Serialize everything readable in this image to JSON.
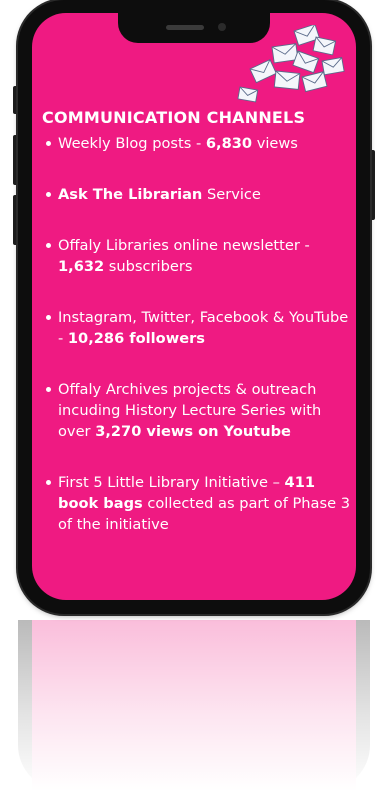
{
  "heading": "COMMUNICATION CHANNELS",
  "items": [
    {
      "parts": [
        {
          "t": "Weekly Blog posts - ",
          "b": false
        },
        {
          "t": "6,830",
          "b": true
        },
        {
          "t": " views",
          "b": false
        }
      ]
    },
    {
      "parts": [
        {
          "t": "Ask The Librarian",
          "b": true
        },
        {
          "t": " Service",
          "b": false
        }
      ]
    },
    {
      "parts": [
        {
          "t": "Offaly Libraries online newsletter - ",
          "b": false
        },
        {
          "t": "1,632",
          "b": true
        },
        {
          "t": " subscribers",
          "b": false
        }
      ]
    },
    {
      "parts": [
        {
          "t": "Instagram, Twitter, Facebook  & YouTube -  ",
          "b": false
        },
        {
          "t": "10,286 followers",
          "b": true
        }
      ]
    },
    {
      "parts": [
        {
          "t": "Offaly Archives projects & outreach incuding History Lecture Series with over ",
          "b": false
        },
        {
          "t": "3,270 views on Youtube",
          "b": true
        }
      ]
    },
    {
      "parts": [
        {
          "t": "First 5 Little Library Initiative – ",
          "b": false
        },
        {
          "t": "411 book bags",
          "b": true
        },
        {
          "t": " collected as part of Phase 3 of the initiative",
          "b": false
        }
      ]
    }
  ],
  "colors": {
    "screen": "#ef1a82",
    "frame": "#0d0d0d",
    "text": "#ffffff"
  },
  "icons": {
    "decoration": "envelopes-icon"
  }
}
